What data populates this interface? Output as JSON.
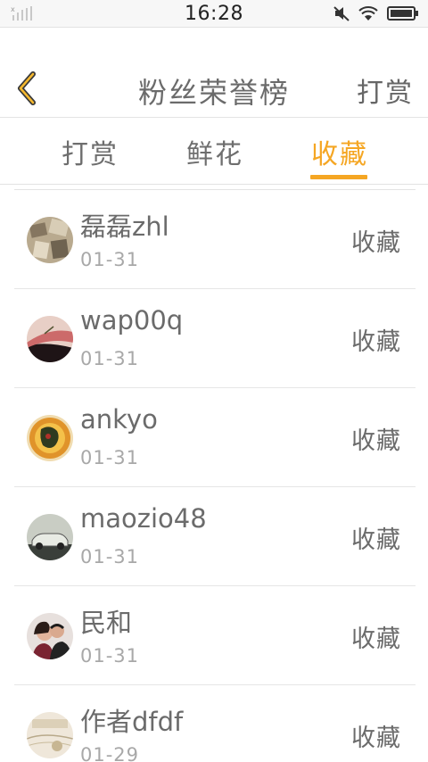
{
  "status_bar": {
    "time": "16:28",
    "icons": [
      "signal-icon",
      "mute-icon",
      "wifi-icon",
      "battery-icon"
    ]
  },
  "header": {
    "back_icon": "chevron-left-icon",
    "title": "粉丝荣誉榜",
    "action_label": "打赏"
  },
  "tabs": [
    {
      "label": "打赏",
      "active": false
    },
    {
      "label": "鲜花",
      "active": false
    },
    {
      "label": "收藏",
      "active": true
    }
  ],
  "colors": {
    "accent": "#f5a623",
    "text": "#6b6b6b",
    "subtext": "#a8a8a8",
    "divider": "#e3e3e3"
  },
  "fans": [
    {
      "name": "磊磊zhl",
      "date": "01-31",
      "type": "收藏"
    },
    {
      "name": "wap00q",
      "date": "01-31",
      "type": "收藏"
    },
    {
      "name": "ankyo",
      "date": "01-31",
      "type": "收藏"
    },
    {
      "name": "maozio48",
      "date": "01-31",
      "type": "收藏"
    },
    {
      "name": "民和",
      "date": "01-31",
      "type": "收藏"
    },
    {
      "name": "作者dfdf",
      "date": "01-29",
      "type": "收藏"
    }
  ]
}
